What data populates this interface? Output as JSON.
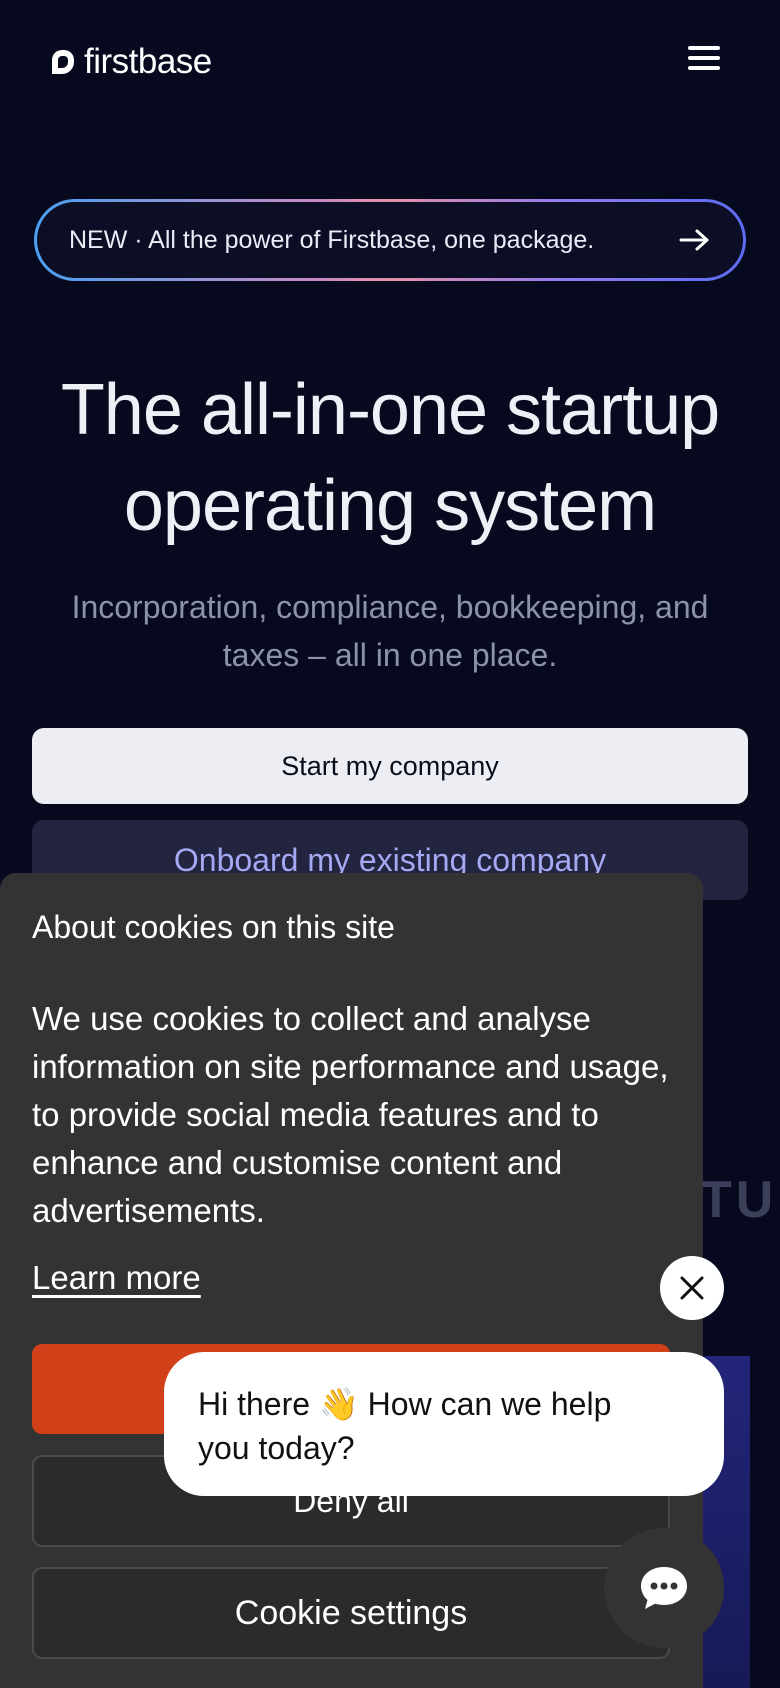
{
  "header": {
    "brand": "firstbase",
    "menu_icon": "hamburger-menu-icon"
  },
  "announcement": {
    "text": "NEW · All the power of Firstbase, one package.",
    "arrow_icon": "arrow-right-icon"
  },
  "hero": {
    "title_line1": "The all-in-one startup",
    "title_line2": "operating system",
    "subtitle_line1": "Incorporation, compliance, bookkeeping, and",
    "subtitle_line2": "taxes – all in one place.",
    "primary_cta": "Start my company",
    "secondary_cta": "Onboard my existing company"
  },
  "background": {
    "partial_text": "TU"
  },
  "cookie_banner": {
    "title": "About cookies on this site",
    "body": "We use cookies to collect and analyse information on site performance and usage, to provide social media features and to enhance and customise content and advertisements.",
    "learn_more": "Learn more",
    "accept_label": "",
    "deny_label": "Deny all",
    "settings_label": "Cookie settings"
  },
  "chat": {
    "greeting_line1": "Hi there 👋 How can we help",
    "greeting_line2": "you today?",
    "close_icon": "close-icon",
    "launcher_icon": "chat-bubble-icon"
  },
  "colors": {
    "page_bg": "#070a1f",
    "accept_bg": "#d2401a",
    "cookie_bg": "#333333",
    "secondary_cta_text": "#a5a8f2"
  }
}
